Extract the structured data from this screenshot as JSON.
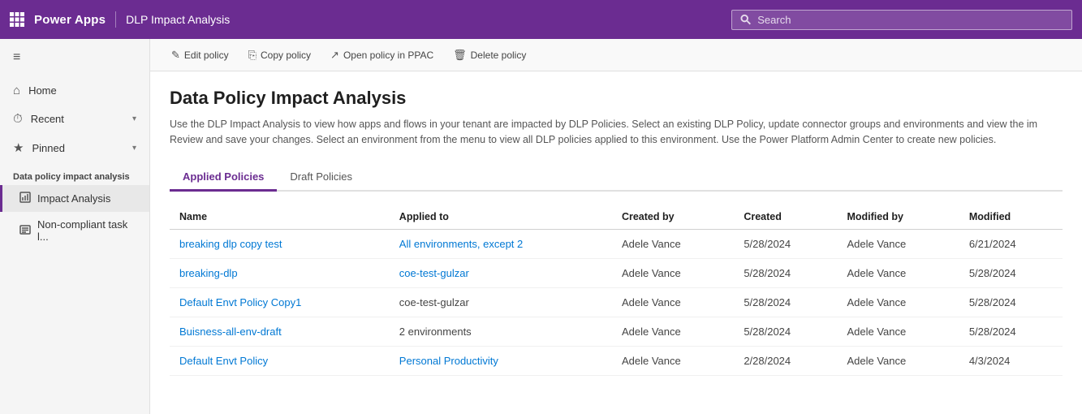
{
  "topnav": {
    "brand": "Power Apps",
    "page_title": "DLP Impact Analysis",
    "search_placeholder": "Search"
  },
  "sidebar": {
    "toggle_icon": "≡",
    "nav_items": [
      {
        "id": "home",
        "icon": "⌂",
        "label": "Home",
        "chevron": ""
      },
      {
        "id": "recent",
        "icon": "⏱",
        "label": "Recent",
        "chevron": "▾"
      },
      {
        "id": "pinned",
        "icon": "★",
        "label": "Pinned",
        "chevron": "▾"
      }
    ],
    "section_label": "Data policy impact analysis",
    "sub_items": [
      {
        "id": "impact-analysis",
        "icon": "📊",
        "label": "Impact Analysis",
        "active": true
      },
      {
        "id": "non-compliant",
        "icon": "📋",
        "label": "Non-compliant task l...",
        "active": false
      }
    ]
  },
  "toolbar": {
    "buttons": [
      {
        "id": "edit-policy",
        "icon": "✎",
        "label": "Edit policy"
      },
      {
        "id": "copy-policy",
        "icon": "⎘",
        "label": "Copy policy"
      },
      {
        "id": "open-ppac",
        "icon": "↗",
        "label": "Open policy in PPAC"
      },
      {
        "id": "delete-policy",
        "icon": "🗑",
        "label": "Delete policy"
      }
    ]
  },
  "page": {
    "title": "Data Policy Impact Analysis",
    "description_part1": "Use the DLP Impact Analysis to view how apps and flows in your tenant are impacted by DLP Policies. Select an existing DLP Policy, update connector groups and environments and view the im",
    "description_part2": "Review and save your changes. Select an environment from the menu to view all DLP policies applied to this environment. Use the Power Platform Admin Center to create new policies.",
    "tabs": [
      {
        "id": "applied",
        "label": "Applied Policies",
        "active": true
      },
      {
        "id": "draft",
        "label": "Draft Policies",
        "active": false
      }
    ],
    "table": {
      "columns": [
        "Name",
        "Applied to",
        "Created by",
        "Created",
        "Modified by",
        "Modified"
      ],
      "rows": [
        {
          "name": "breaking dlp copy test",
          "applied_to": "All environments, except 2",
          "created_by": "Adele Vance",
          "created": "5/28/2024",
          "modified_by": "Adele Vance",
          "modified": "6/21/2024",
          "name_is_link": true,
          "applied_is_link": true
        },
        {
          "name": "breaking-dlp",
          "applied_to": "coe-test-gulzar",
          "created_by": "Adele Vance",
          "created": "5/28/2024",
          "modified_by": "Adele Vance",
          "modified": "5/28/2024",
          "name_is_link": true,
          "applied_is_link": true
        },
        {
          "name": "Default Envt Policy Copy1",
          "applied_to": "coe-test-gulzar",
          "created_by": "Adele Vance",
          "created": "5/28/2024",
          "modified_by": "Adele Vance",
          "modified": "5/28/2024",
          "name_is_link": true,
          "applied_is_link": false
        },
        {
          "name": "Buisness-all-env-draft",
          "applied_to": "2 environments",
          "created_by": "Adele Vance",
          "created": "5/28/2024",
          "modified_by": "Adele Vance",
          "modified": "5/28/2024",
          "name_is_link": true,
          "applied_is_link": false
        },
        {
          "name": "Default Envt Policy",
          "applied_to": "Personal Productivity",
          "created_by": "Adele Vance",
          "created": "2/28/2024",
          "modified_by": "Adele Vance",
          "modified": "4/3/2024",
          "name_is_link": true,
          "applied_is_link": true
        }
      ]
    }
  }
}
